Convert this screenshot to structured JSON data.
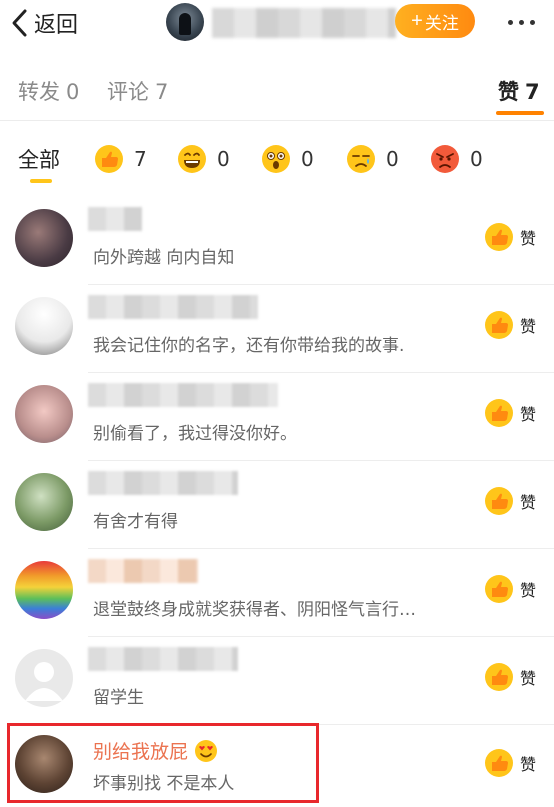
{
  "header": {
    "back_label": "返回",
    "follow_label": "关注"
  },
  "tabs": [
    {
      "label": "转发",
      "count": "0"
    },
    {
      "label": "评论",
      "count": "7"
    },
    {
      "label": "赞",
      "count": "7"
    }
  ],
  "filters": {
    "all_label": "全部",
    "reactions": [
      {
        "icon": "thumbs-up-face-icon",
        "count": "7"
      },
      {
        "icon": "laughing-face-icon",
        "count": "0"
      },
      {
        "icon": "surprised-face-icon",
        "count": "0"
      },
      {
        "icon": "sad-face-icon",
        "count": "0"
      },
      {
        "icon": "angry-face-icon",
        "count": "0"
      }
    ]
  },
  "like_label": "赞",
  "users": [
    {
      "name": "",
      "desc": "向外跨越 向内自知"
    },
    {
      "name": "",
      "desc": "我会记住你的名字，还有你带给我的故事."
    },
    {
      "name": "",
      "desc": "别偷看了，我过得没你好。"
    },
    {
      "name": "",
      "desc": "有舍才有得"
    },
    {
      "name": "",
      "desc": "退堂鼓终身成就奖获得者、阴阳怪气言行…"
    },
    {
      "name": "",
      "desc": "留学生"
    },
    {
      "name": "别给我放屁",
      "desc": "坏事别找 不是本人"
    }
  ],
  "colors": {
    "accent_orange": "#ff8200",
    "highlight_red": "#e8282c",
    "name_orange": "#eb7350"
  }
}
